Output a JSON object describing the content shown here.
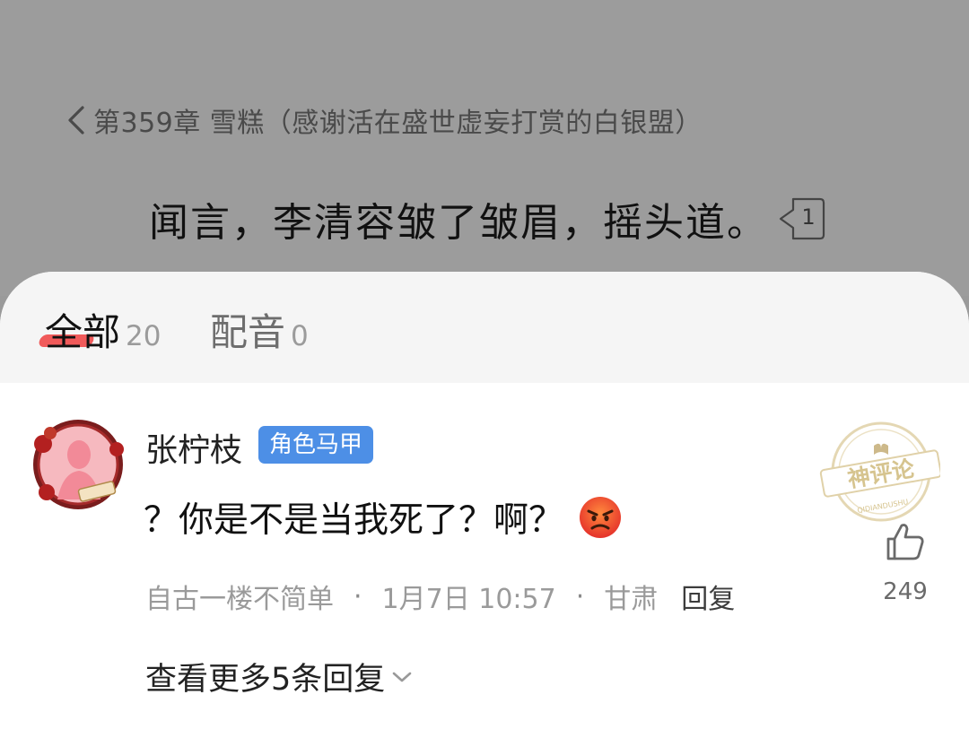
{
  "reader": {
    "chapter_title": "第359章 雪糕（感谢活在盛世虚妄打赏的白银盟）",
    "paragraph": "闻言，李清容皱了皱眉，摇头道。",
    "paragraph_comment_count": "1"
  },
  "tabs": [
    {
      "label": "全部",
      "count": "20",
      "active": true
    },
    {
      "label": "配音",
      "count": "0",
      "active": false
    }
  ],
  "comment": {
    "username": "张柠枝",
    "badge": "角色马甲",
    "text": "？你是不是当我死了？啊？",
    "emoji": "angry-face",
    "meta": {
      "tag": "自古一楼不简单",
      "time": "1月7日 10:57",
      "location": "甘肃",
      "reply_label": "回复"
    },
    "stamp_text": "神评论",
    "stamp_subtext": "QIDIANDUSHU",
    "likes": "249",
    "more_replies": "查看更多5条回复"
  },
  "colors": {
    "accent_red": "#f05a5a",
    "badge_blue": "#4d8fe6",
    "stamp_gold": "#d8c79a"
  }
}
